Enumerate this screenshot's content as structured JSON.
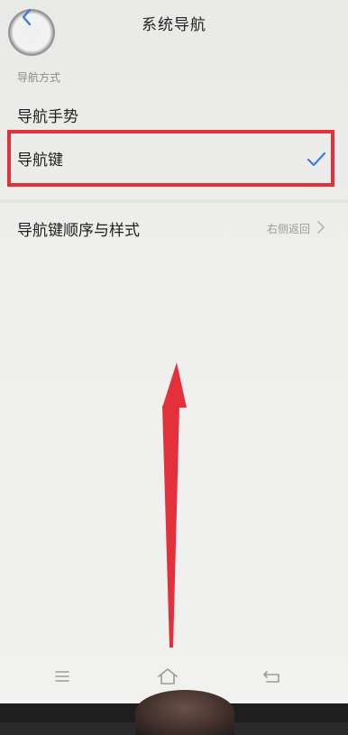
{
  "header": {
    "title": "系统导航",
    "back_icon": "chevron-left-icon"
  },
  "section": {
    "title": "导航方式"
  },
  "options": [
    {
      "label": "导航手势",
      "selected": false
    },
    {
      "label": "导航键",
      "selected": true
    }
  ],
  "order_row": {
    "label": "导航键顺序与样式",
    "value": "右侧返回",
    "icon": "chevron-right-icon"
  },
  "colors": {
    "accent": "#3d7be0",
    "highlight": "#e3303a",
    "background": "#efefed"
  },
  "navbar": {
    "icons": [
      "menu-icon",
      "home-icon",
      "back-icon"
    ]
  }
}
